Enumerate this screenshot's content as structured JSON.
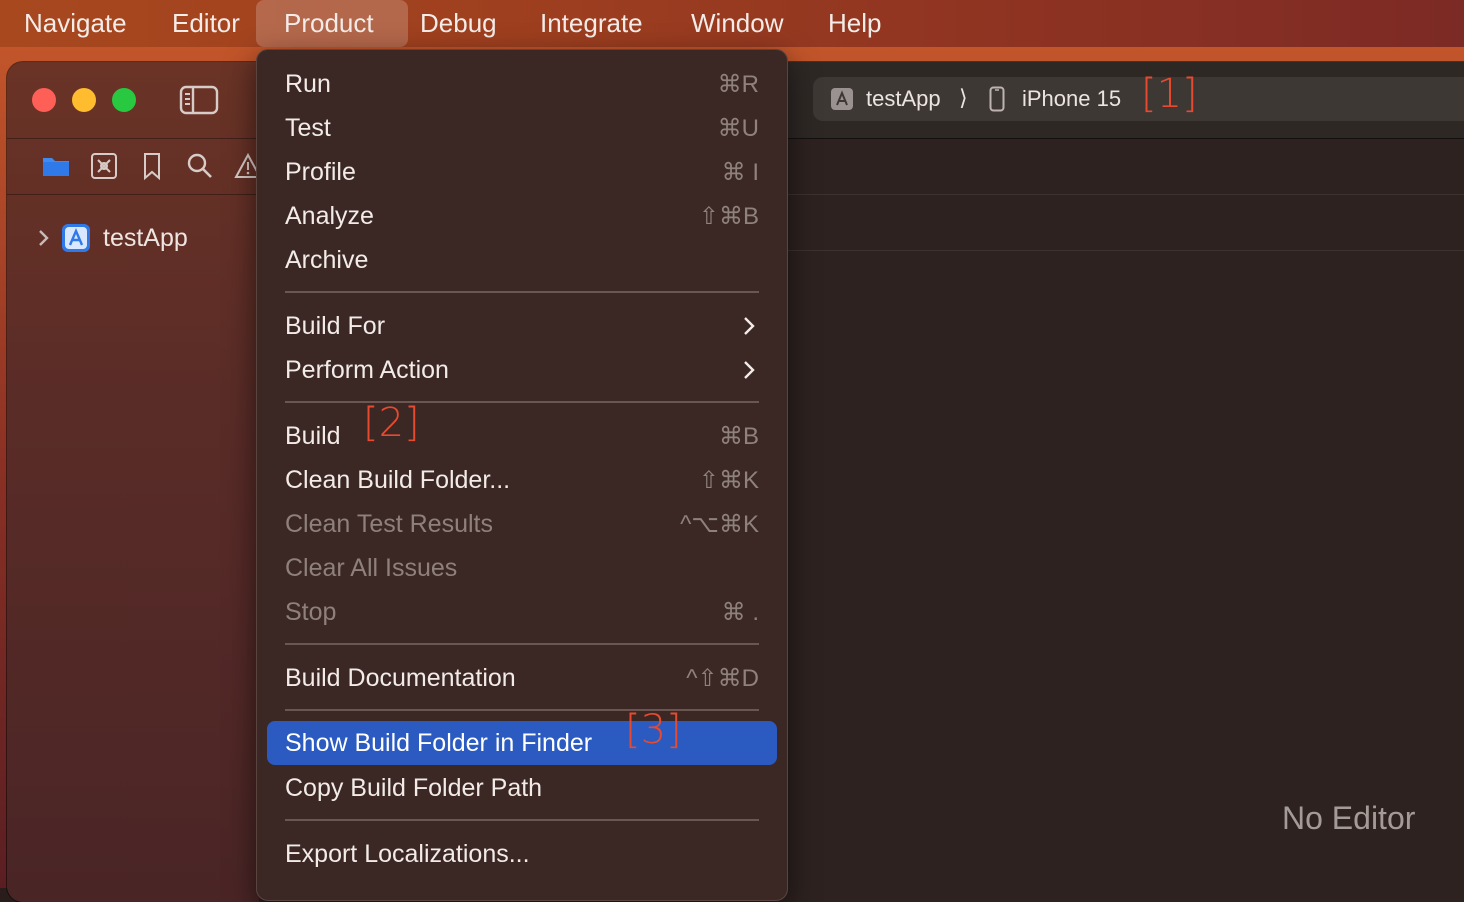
{
  "menubar": {
    "items": [
      "Navigate",
      "Editor",
      "Product",
      "Debug",
      "Integrate",
      "Window",
      "Help"
    ],
    "active": "Product"
  },
  "sidebar": {
    "project_name": "testApp"
  },
  "toolbar": {
    "scheme_app": "testApp",
    "scheme_separator": "⟩",
    "scheme_device": "iPhone 15",
    "mark1": "[1]"
  },
  "editor": {
    "placeholder": "No Editor"
  },
  "product_menu": {
    "run": {
      "label": "Run",
      "shortcut": "⌘R"
    },
    "test": {
      "label": "Test",
      "shortcut": "⌘U"
    },
    "profile": {
      "label": "Profile",
      "shortcut": "⌘ I"
    },
    "analyze": {
      "label": "Analyze",
      "shortcut": "⇧⌘B"
    },
    "archive": {
      "label": "Archive"
    },
    "build_for": {
      "label": "Build For"
    },
    "perform_action": {
      "label": "Perform Action"
    },
    "build": {
      "label": "Build",
      "shortcut": "⌘B",
      "mark": "[2]"
    },
    "clean_build_folder": {
      "label": "Clean Build Folder...",
      "shortcut": "⇧⌘K"
    },
    "clean_test_results": {
      "label": "Clean Test Results",
      "shortcut": "^⌥⌘K"
    },
    "clear_all_issues": {
      "label": "Clear All Issues"
    },
    "stop": {
      "label": "Stop",
      "shortcut": "⌘ ."
    },
    "build_documentation": {
      "label": "Build Documentation",
      "shortcut": "^⇧⌘D"
    },
    "show_build_folder": {
      "label": "Show Build Folder in Finder",
      "mark": "[3]"
    },
    "copy_build_folder_path": {
      "label": "Copy Build Folder Path"
    },
    "export_localizations": {
      "label": "Export Localizations..."
    }
  },
  "colors": {
    "highlight": "#2b5bc0",
    "annotation": "#e84a2f"
  }
}
